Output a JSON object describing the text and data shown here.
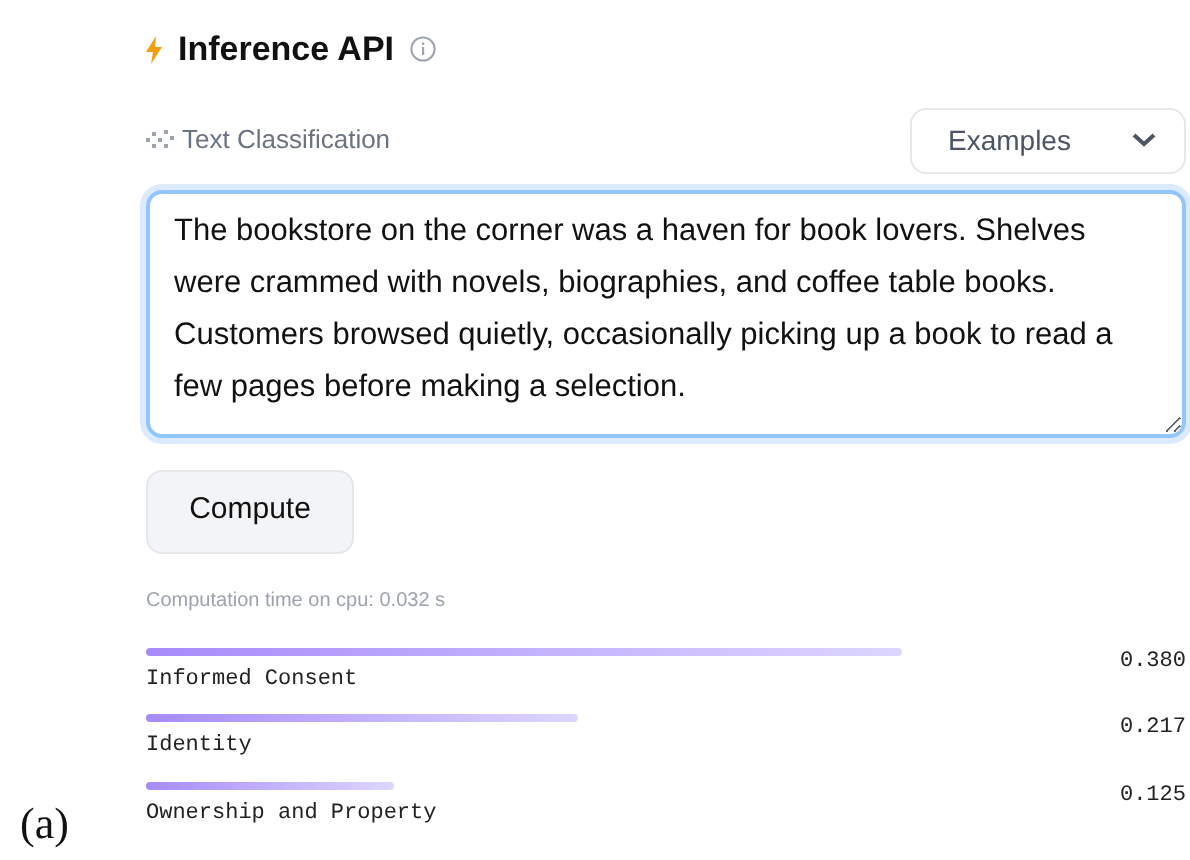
{
  "figure_label": "(a)",
  "header": {
    "title": "Inference API",
    "task": "Text Classification",
    "examples_dropdown": "Examples"
  },
  "input": {
    "value": "The bookstore on the corner was a haven for book lovers. Shelves were crammed with novels, biographies, and coffee table books. Customers browsed quietly, occasionally picking up a book to read a few pages before making a selection."
  },
  "compute_button": "Compute",
  "computation_time": "Computation time on cpu: 0.032 s",
  "results": [
    {
      "label": "Informed Consent",
      "score": "0.380"
    },
    {
      "label": "Identity",
      "score": "0.217"
    },
    {
      "label": "Ownership and Property",
      "score": "0.125"
    }
  ]
}
